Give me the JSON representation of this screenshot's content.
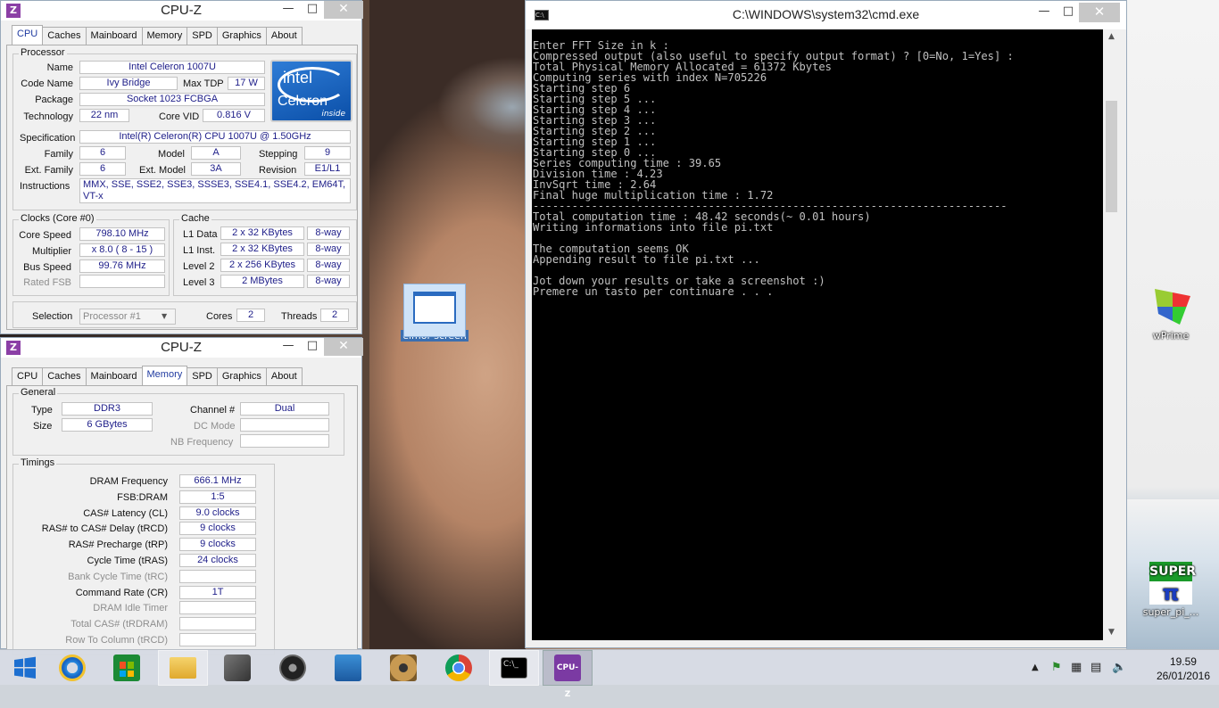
{
  "desktop": {
    "icons": [
      {
        "label": "elmor-screen"
      },
      {
        "label": "wPrime"
      },
      {
        "label": "super_pi_..."
      }
    ]
  },
  "cpuz1": {
    "title": "CPU-Z",
    "tabs": [
      "CPU",
      "Caches",
      "Mainboard",
      "Memory",
      "SPD",
      "Graphics",
      "About"
    ],
    "active_tab": "CPU",
    "processor": {
      "group": "Processor",
      "name_label": "Name",
      "name": "Intel Celeron 1007U",
      "codename_label": "Code Name",
      "codename": "Ivy Bridge",
      "maxtdp_label": "Max TDP",
      "maxtdp": "17 W",
      "package_label": "Package",
      "package": "Socket 1023 FCBGA",
      "technology_label": "Technology",
      "technology": "22 nm",
      "corevid_label": "Core VID",
      "corevid": "0.816 V",
      "spec_label": "Specification",
      "spec": "Intel(R) Celeron(R) CPU 1007U @ 1.50GHz",
      "family_label": "Family",
      "family": "6",
      "model_label": "Model",
      "model": "A",
      "stepping_label": "Stepping",
      "stepping": "9",
      "extfamily_label": "Ext. Family",
      "extfamily": "6",
      "extmodel_label": "Ext. Model",
      "extmodel": "3A",
      "revision_label": "Revision",
      "revision": "E1/L1",
      "instr_label": "Instructions",
      "instr": "MMX, SSE, SSE2, SSE3, SSSE3, SSE4.1, SSE4.2, EM64T, VT-x",
      "logo_brand": "intel",
      "logo_product": "Celeron",
      "logo_tag": "inside"
    },
    "clocks": {
      "group": "Clocks (Core #0)",
      "corespeed_label": "Core Speed",
      "corespeed": "798.10 MHz",
      "multiplier_label": "Multiplier",
      "multiplier": "x 8.0 ( 8 - 15 )",
      "busspeed_label": "Bus Speed",
      "busspeed": "99.76 MHz",
      "ratedfsb_label": "Rated FSB",
      "ratedfsb": ""
    },
    "cache": {
      "group": "Cache",
      "rows": [
        {
          "label": "L1 Data",
          "size": "2 x 32 KBytes",
          "way": "8-way"
        },
        {
          "label": "L1 Inst.",
          "size": "2 x 32 KBytes",
          "way": "8-way"
        },
        {
          "label": "Level 2",
          "size": "2 x 256 KBytes",
          "way": "8-way"
        },
        {
          "label": "Level 3",
          "size": "2 MBytes",
          "way": "8-way"
        }
      ]
    },
    "selection_label": "Selection",
    "selection": "Processor #1",
    "cores_label": "Cores",
    "cores": "2",
    "threads_label": "Threads",
    "threads": "2"
  },
  "cpuz2": {
    "title": "CPU-Z",
    "tabs": [
      "CPU",
      "Caches",
      "Mainboard",
      "Memory",
      "SPD",
      "Graphics",
      "About"
    ],
    "active_tab": "Memory",
    "general": {
      "group": "General",
      "type_label": "Type",
      "type": "DDR3",
      "size_label": "Size",
      "size": "6 GBytes",
      "channel_label": "Channel #",
      "channel": "Dual",
      "dcmode_label": "DC Mode",
      "dcmode": "",
      "nbfreq_label": "NB Frequency",
      "nbfreq": ""
    },
    "timings": {
      "group": "Timings",
      "rows": [
        {
          "label": "DRAM Frequency",
          "value": "666.1 MHz",
          "grey": false
        },
        {
          "label": "FSB:DRAM",
          "value": "1:5",
          "grey": false
        },
        {
          "label": "CAS# Latency (CL)",
          "value": "9.0 clocks",
          "grey": false
        },
        {
          "label": "RAS# to CAS# Delay (tRCD)",
          "value": "9 clocks",
          "grey": false
        },
        {
          "label": "RAS# Precharge (tRP)",
          "value": "9 clocks",
          "grey": false
        },
        {
          "label": "Cycle Time (tRAS)",
          "value": "24 clocks",
          "grey": false
        },
        {
          "label": "Bank Cycle Time (tRC)",
          "value": "",
          "grey": true
        },
        {
          "label": "Command Rate (CR)",
          "value": "1T",
          "grey": false
        },
        {
          "label": "DRAM Idle Timer",
          "value": "",
          "grey": true
        },
        {
          "label": "Total CAS# (tRDRAM)",
          "value": "",
          "grey": true
        },
        {
          "label": "Row To Column (tRCD)",
          "value": "",
          "grey": true
        }
      ]
    }
  },
  "cmd": {
    "title": "C:\\WINDOWS\\system32\\cmd.exe",
    "lines": [
      "Enter FFT Size in k :",
      "Compressed output (also useful to specify output format) ? [0=No, 1=Yes] :",
      "Total Physical Memory Allocated = 61372 Kbytes",
      "Computing series with index N=705226",
      "Starting step 6",
      "Starting step 5 ...",
      "Starting step 4 ...",
      "Starting step 3 ...",
      "Starting step 2 ...",
      "Starting step 1 ...",
      "Starting step 0 ...",
      "Series computing time : 39.65",
      "Division time : 4.23",
      "InvSqrt time : 2.64",
      "Final huge multiplication time : 1.72",
      "-------------------------------------------------------------------------",
      "Total computation time : 48.42 seconds(~ 0.01 hours)",
      "Writing informations into file pi.txt",
      "",
      "The computation seems OK",
      "Appending result to file pi.txt ...",
      "",
      "Jot down your results or take a screenshot :)",
      "Premere un tasto per continuare . . ."
    ]
  },
  "taskbar": {
    "clock_time": "19.59",
    "clock_date": "26/01/2016",
    "apps": [
      {
        "name": "start",
        "icon": "windows-logo-icon"
      },
      {
        "name": "ie",
        "icon": "internet-explorer-icon"
      },
      {
        "name": "store",
        "icon": "store-icon"
      },
      {
        "name": "explorer",
        "icon": "file-explorer-icon"
      },
      {
        "name": "doc",
        "icon": "document-tool-icon"
      },
      {
        "name": "speaker",
        "icon": "audio-app-icon"
      },
      {
        "name": "control",
        "icon": "control-panel-icon"
      },
      {
        "name": "gpu",
        "icon": "disk-tool-icon"
      },
      {
        "name": "chrome",
        "icon": "chrome-icon"
      },
      {
        "name": "cmd",
        "icon": "cmd-icon"
      },
      {
        "name": "cpuz",
        "icon": "cpuz-icon"
      }
    ]
  }
}
